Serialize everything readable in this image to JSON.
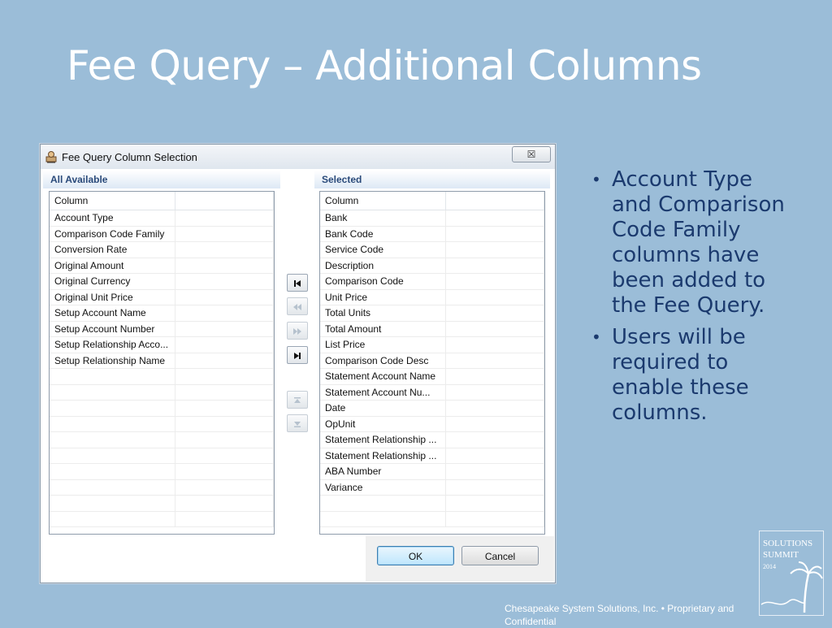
{
  "slide": {
    "title": "Fee Query – Additional Columns",
    "bullets": [
      "Account Type and Comparison Code Family columns have been added to the Fee Query.",
      "Users will be required to enable these columns."
    ],
    "footer": "Chesapeake System Solutions, Inc.  •  Proprietary and Confidential",
    "logo": {
      "line1": "SOLUTIONS",
      "line2": "SUMMIT",
      "year": "2014"
    }
  },
  "dialog": {
    "title": "Fee Query Column Selection",
    "title_icon": "query-icon",
    "close_label": "☒",
    "available": {
      "header": "All Available",
      "column_header": "Column",
      "items": [
        "Account Type",
        "Comparison Code Family",
        "Conversion Rate",
        "Original Amount",
        "Original Currency",
        "Original Unit Price",
        "Setup Account Name",
        "Setup Account Number",
        "Setup Relationship Acco...",
        "Setup Relationship Name"
      ]
    },
    "selected": {
      "header": "Selected",
      "column_header": "Column",
      "items": [
        "Bank",
        "Bank Code",
        "Service Code",
        "Description",
        "Comparison Code",
        "Unit Price",
        "Total Units",
        "Total Amount",
        "List Price",
        "Comparison Code Desc",
        "Statement Account Name",
        "Statement Account Nu...",
        "Date",
        "OpUnit",
        "Statement Relationship ...",
        "Statement Relationship ...",
        "ABA Number",
        "Variance"
      ]
    },
    "move_buttons": {
      "move_all_left": "◀",
      "move_left": "◀◀",
      "move_right": "▶▶",
      "move_all_right": "▶",
      "move_up": "▲",
      "move_down": "▼"
    },
    "ok_label": "OK",
    "cancel_label": "Cancel"
  }
}
